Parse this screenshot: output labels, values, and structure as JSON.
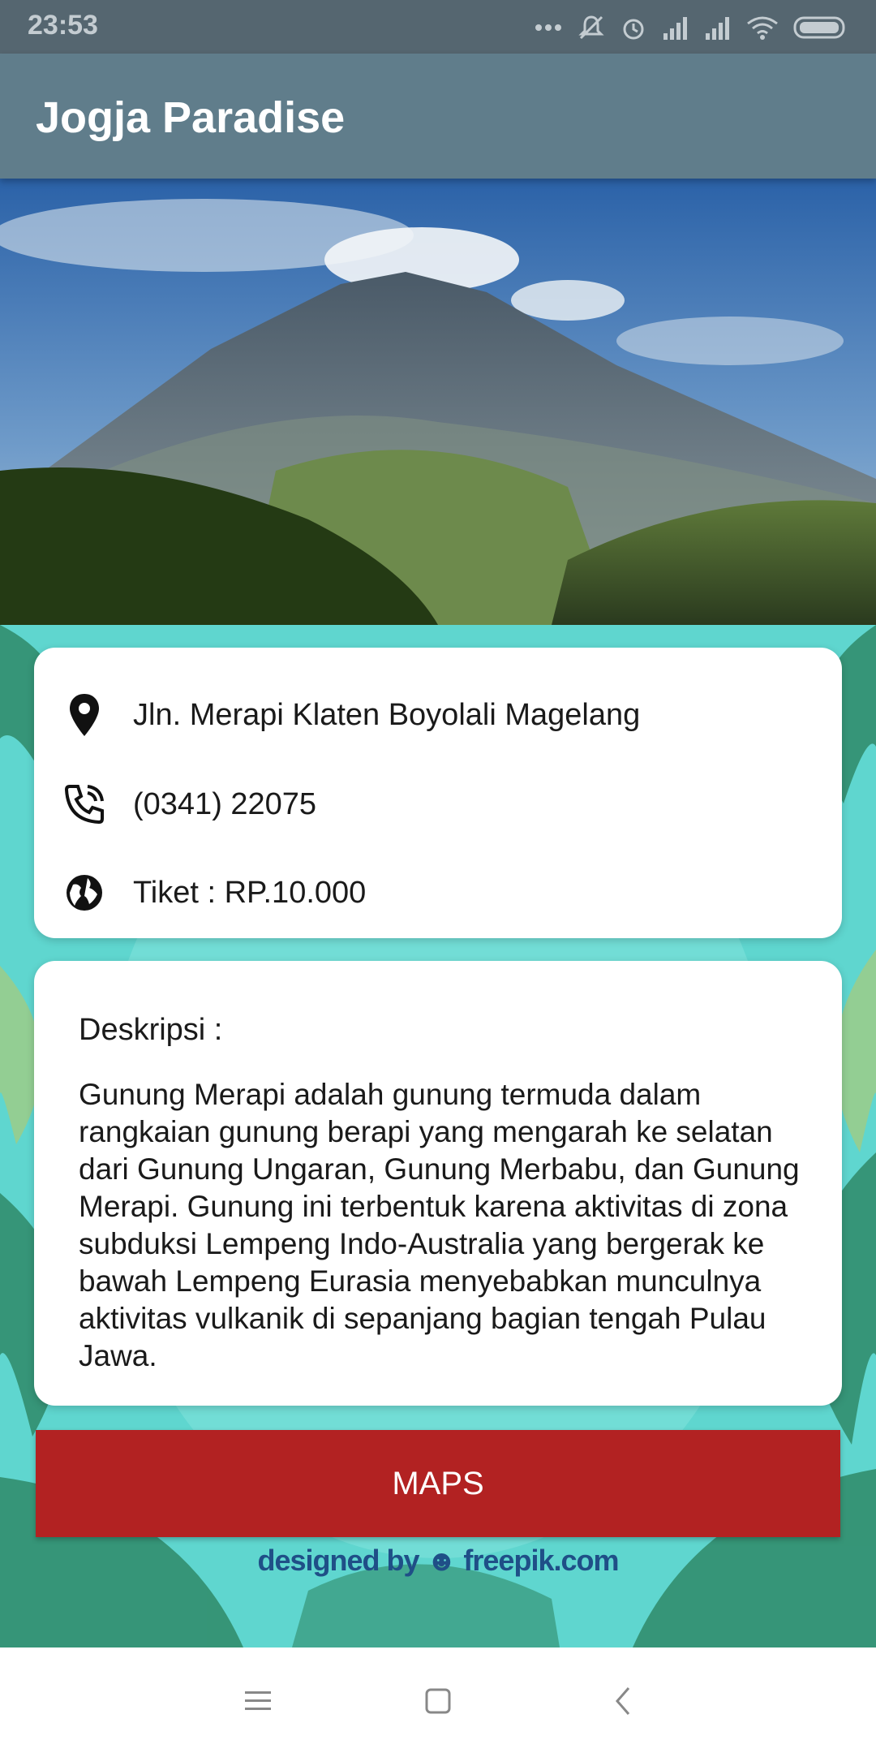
{
  "status_bar": {
    "time": "23:53",
    "icons": [
      "more-dots-icon",
      "mute-icon",
      "alarm-icon",
      "signal-icon",
      "signal-icon",
      "wifi-icon",
      "battery-icon"
    ]
  },
  "app_bar": {
    "title": "Jogja Paradise"
  },
  "hero": {
    "image": "mountain-photo"
  },
  "info": {
    "address": "Jln. Merapi Klaten Boyolali Magelang",
    "phone": "(0341) 22075",
    "ticket": "Tiket : RP.10.000"
  },
  "description": {
    "label": "Deskripsi :",
    "text": "Gunung Merapi adalah gunung termuda dalam rangkaian gunung berapi yang mengarah ke selatan dari Gunung Ungaran, Gunung Merbabu, dan Gunung Merapi. Gunung ini terbentuk karena aktivitas di zona subduksi Lempeng Indo-Australia yang bergerak ke bawah Lempeng Eurasia menyebabkan munculnya aktivitas vulkanik di sepanjang bagian tengah Pulau Jawa."
  },
  "maps_button": {
    "label": "MAPS",
    "color": "#b22222"
  },
  "credit": {
    "text": "designed by ☻ freepik.com"
  },
  "colors": {
    "app_bar": "#607d8b",
    "status_bar": "#556670",
    "background": "#5fd6cf"
  },
  "nav_bar": {
    "buttons": [
      "menu-icon",
      "home-icon",
      "back-icon"
    ]
  }
}
